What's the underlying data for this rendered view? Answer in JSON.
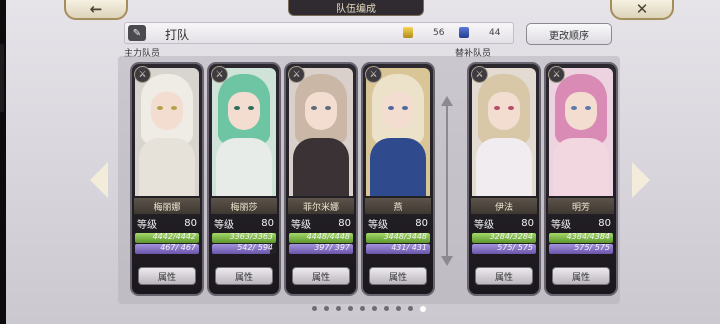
{
  "title": "队伍编成",
  "top_buttons": {
    "back_glyph": "←",
    "close_glyph": "✕"
  },
  "team": {
    "name": "打队",
    "stat_gold_icon": "gold-rank-icon",
    "stat_gold_value": "56",
    "stat_blue_icon": "blue-rank-icon",
    "stat_blue_value": "44",
    "change_order_label": "更改顺序"
  },
  "sections": {
    "main_label": "主力队员",
    "sub_label": "替补队员"
  },
  "level_label": "等级",
  "attribute_label": "属性",
  "pagination": {
    "total": 10,
    "active_index": 9
  },
  "characters": [
    {
      "name": "梅丽娜",
      "level": "80",
      "hp": "4442/4442",
      "hp_fill": 1.0,
      "mp": "467/ 467",
      "mp_fill": 1.0,
      "group": "main",
      "colors": {
        "bg": "#d8d4cf",
        "hair": "#efece6",
        "eye": "#b7a04a",
        "body": "#e6e1d9"
      }
    },
    {
      "name": "梅丽莎",
      "level": "80",
      "hp": "3363/3363",
      "hp_fill": 1.0,
      "mp": "542/ 594",
      "mp_fill": 0.91,
      "group": "main",
      "colors": {
        "bg": "#cfe3d8",
        "hair": "#6ec5a4",
        "eye": "#2f6e5a",
        "body": "#e8ece8"
      }
    },
    {
      "name": "菲尔米娜",
      "level": "80",
      "hp": "4448/4448",
      "hp_fill": 1.0,
      "mp": "397/ 397",
      "mp_fill": 1.0,
      "group": "main",
      "colors": {
        "bg": "#d9cfcb",
        "hair": "#cbb7a6",
        "eye": "#5d6c7a",
        "body": "#3b3236"
      }
    },
    {
      "name": "燕",
      "level": "80",
      "hp": "3448/3448",
      "hp_fill": 1.0,
      "mp": "431/ 431",
      "mp_fill": 1.0,
      "group": "main",
      "colors": {
        "bg": "#d9c596",
        "hair": "#ece1c9",
        "eye": "#4c6a9e",
        "body": "#2f4b8e"
      }
    },
    {
      "name": "伊法",
      "level": "80",
      "hp": "3284/3284",
      "hp_fill": 1.0,
      "mp": "575/ 575",
      "mp_fill": 1.0,
      "group": "sub",
      "colors": {
        "bg": "#e3dbd2",
        "hair": "#d8c8a7",
        "eye": "#b34e64",
        "body": "#f1ecef"
      }
    },
    {
      "name": "明芳",
      "level": "80",
      "hp": "4384/4384",
      "hp_fill": 1.0,
      "mp": "575/ 575",
      "mp_fill": 1.0,
      "group": "sub",
      "colors": {
        "bg": "#ecd3df",
        "hair": "#d98bb5",
        "eye": "#5b7aa8",
        "body": "#f3d7e0"
      }
    }
  ]
}
